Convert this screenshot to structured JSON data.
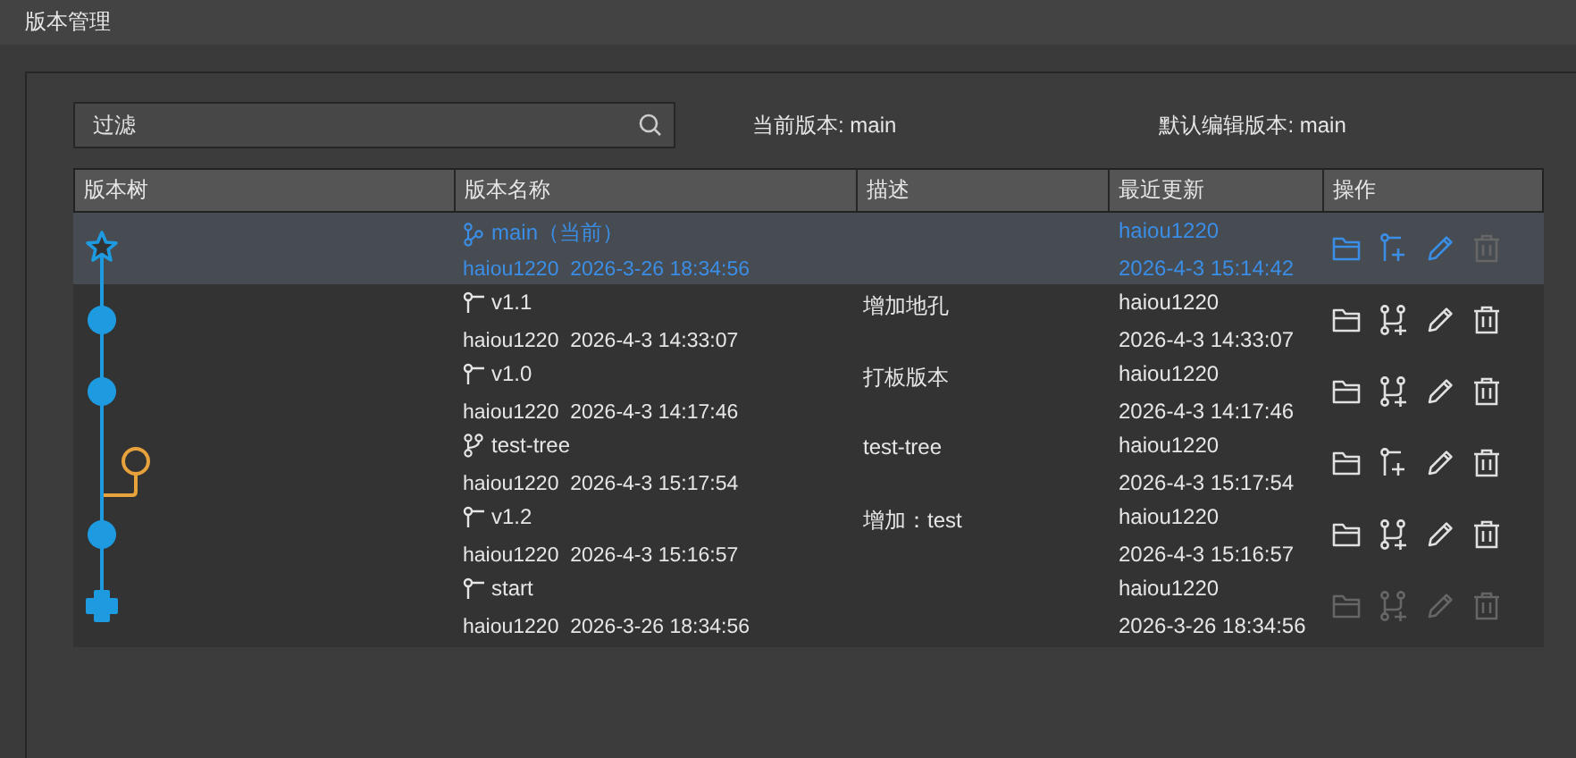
{
  "window": {
    "title": "版本管理"
  },
  "filter": {
    "placeholder": "过滤"
  },
  "current_version": "当前版本: main",
  "default_edit_version": "默认编辑版本: main",
  "table": {
    "columns": [
      "版本树",
      "版本名称",
      "描述",
      "最近更新",
      "操作"
    ],
    "rows": [
      {
        "kind": "star",
        "name": "main（当前）",
        "meta": "haiou1220  2026-3-26 18:34:56",
        "updated_by": "haiou1220",
        "updated_at": "2026-4-3 15:14:42",
        "selected": true,
        "actions": [
          {
            "kind": "folder",
            "disabled": false
          },
          {
            "kind": "branch-add",
            "disabled": false
          },
          {
            "kind": "edit",
            "disabled": false
          },
          {
            "kind": "delete",
            "disabled": true
          }
        ]
      },
      {
        "kind": "dot",
        "name": "v1.1",
        "meta": "haiou1220  2026-4-3 14:33:07",
        "description": "增加地孔",
        "updated_by": "haiou1220",
        "updated_at": "2026-4-3 14:33:07",
        "selected": false,
        "actions": [
          {
            "kind": "folder",
            "disabled": false
          },
          {
            "kind": "merge-add",
            "disabled": false
          },
          {
            "kind": "edit",
            "disabled": false
          },
          {
            "kind": "delete",
            "disabled": false
          }
        ]
      },
      {
        "kind": "dot",
        "name": "v1.0",
        "meta": "haiou1220  2026-4-3 14:17:46",
        "description": "打板版本",
        "updated_by": "haiou1220",
        "updated_at": "2026-4-3 14:17:46",
        "selected": false,
        "actions": [
          {
            "kind": "folder",
            "disabled": false
          },
          {
            "kind": "merge-add",
            "disabled": false
          },
          {
            "kind": "edit",
            "disabled": false
          },
          {
            "kind": "delete",
            "disabled": false
          }
        ]
      },
      {
        "kind": "branch",
        "name": "test-tree",
        "meta": "haiou1220  2026-4-3 15:17:54",
        "description": "test-tree",
        "updated_by": "haiou1220",
        "updated_at": "2026-4-3 15:17:54",
        "selected": false,
        "actions": [
          {
            "kind": "folder",
            "disabled": false
          },
          {
            "kind": "branch-add",
            "disabled": false
          },
          {
            "kind": "edit",
            "disabled": false
          },
          {
            "kind": "delete",
            "disabled": false
          }
        ]
      },
      {
        "kind": "dot",
        "name": "v1.2",
        "meta": "haiou1220  2026-4-3 15:16:57",
        "description": "增加：test",
        "updated_by": "haiou1220",
        "updated_at": "2026-4-3 15:16:57",
        "selected": false,
        "actions": [
          {
            "kind": "folder",
            "disabled": false
          },
          {
            "kind": "merge-add",
            "disabled": false
          },
          {
            "kind": "edit",
            "disabled": false
          },
          {
            "kind": "delete",
            "disabled": false
          }
        ]
      },
      {
        "kind": "start",
        "name": "start",
        "meta": "haiou1220  2026-3-26 18:34:56",
        "updated_by": "haiou1220",
        "updated_at": "2026-3-26 18:34:56",
        "selected": false,
        "actions": [
          {
            "kind": "folder",
            "disabled": true
          },
          {
            "kind": "merge-add",
            "disabled": true
          },
          {
            "kind": "edit",
            "disabled": true
          },
          {
            "kind": "delete",
            "disabled": true
          }
        ]
      }
    ]
  }
}
